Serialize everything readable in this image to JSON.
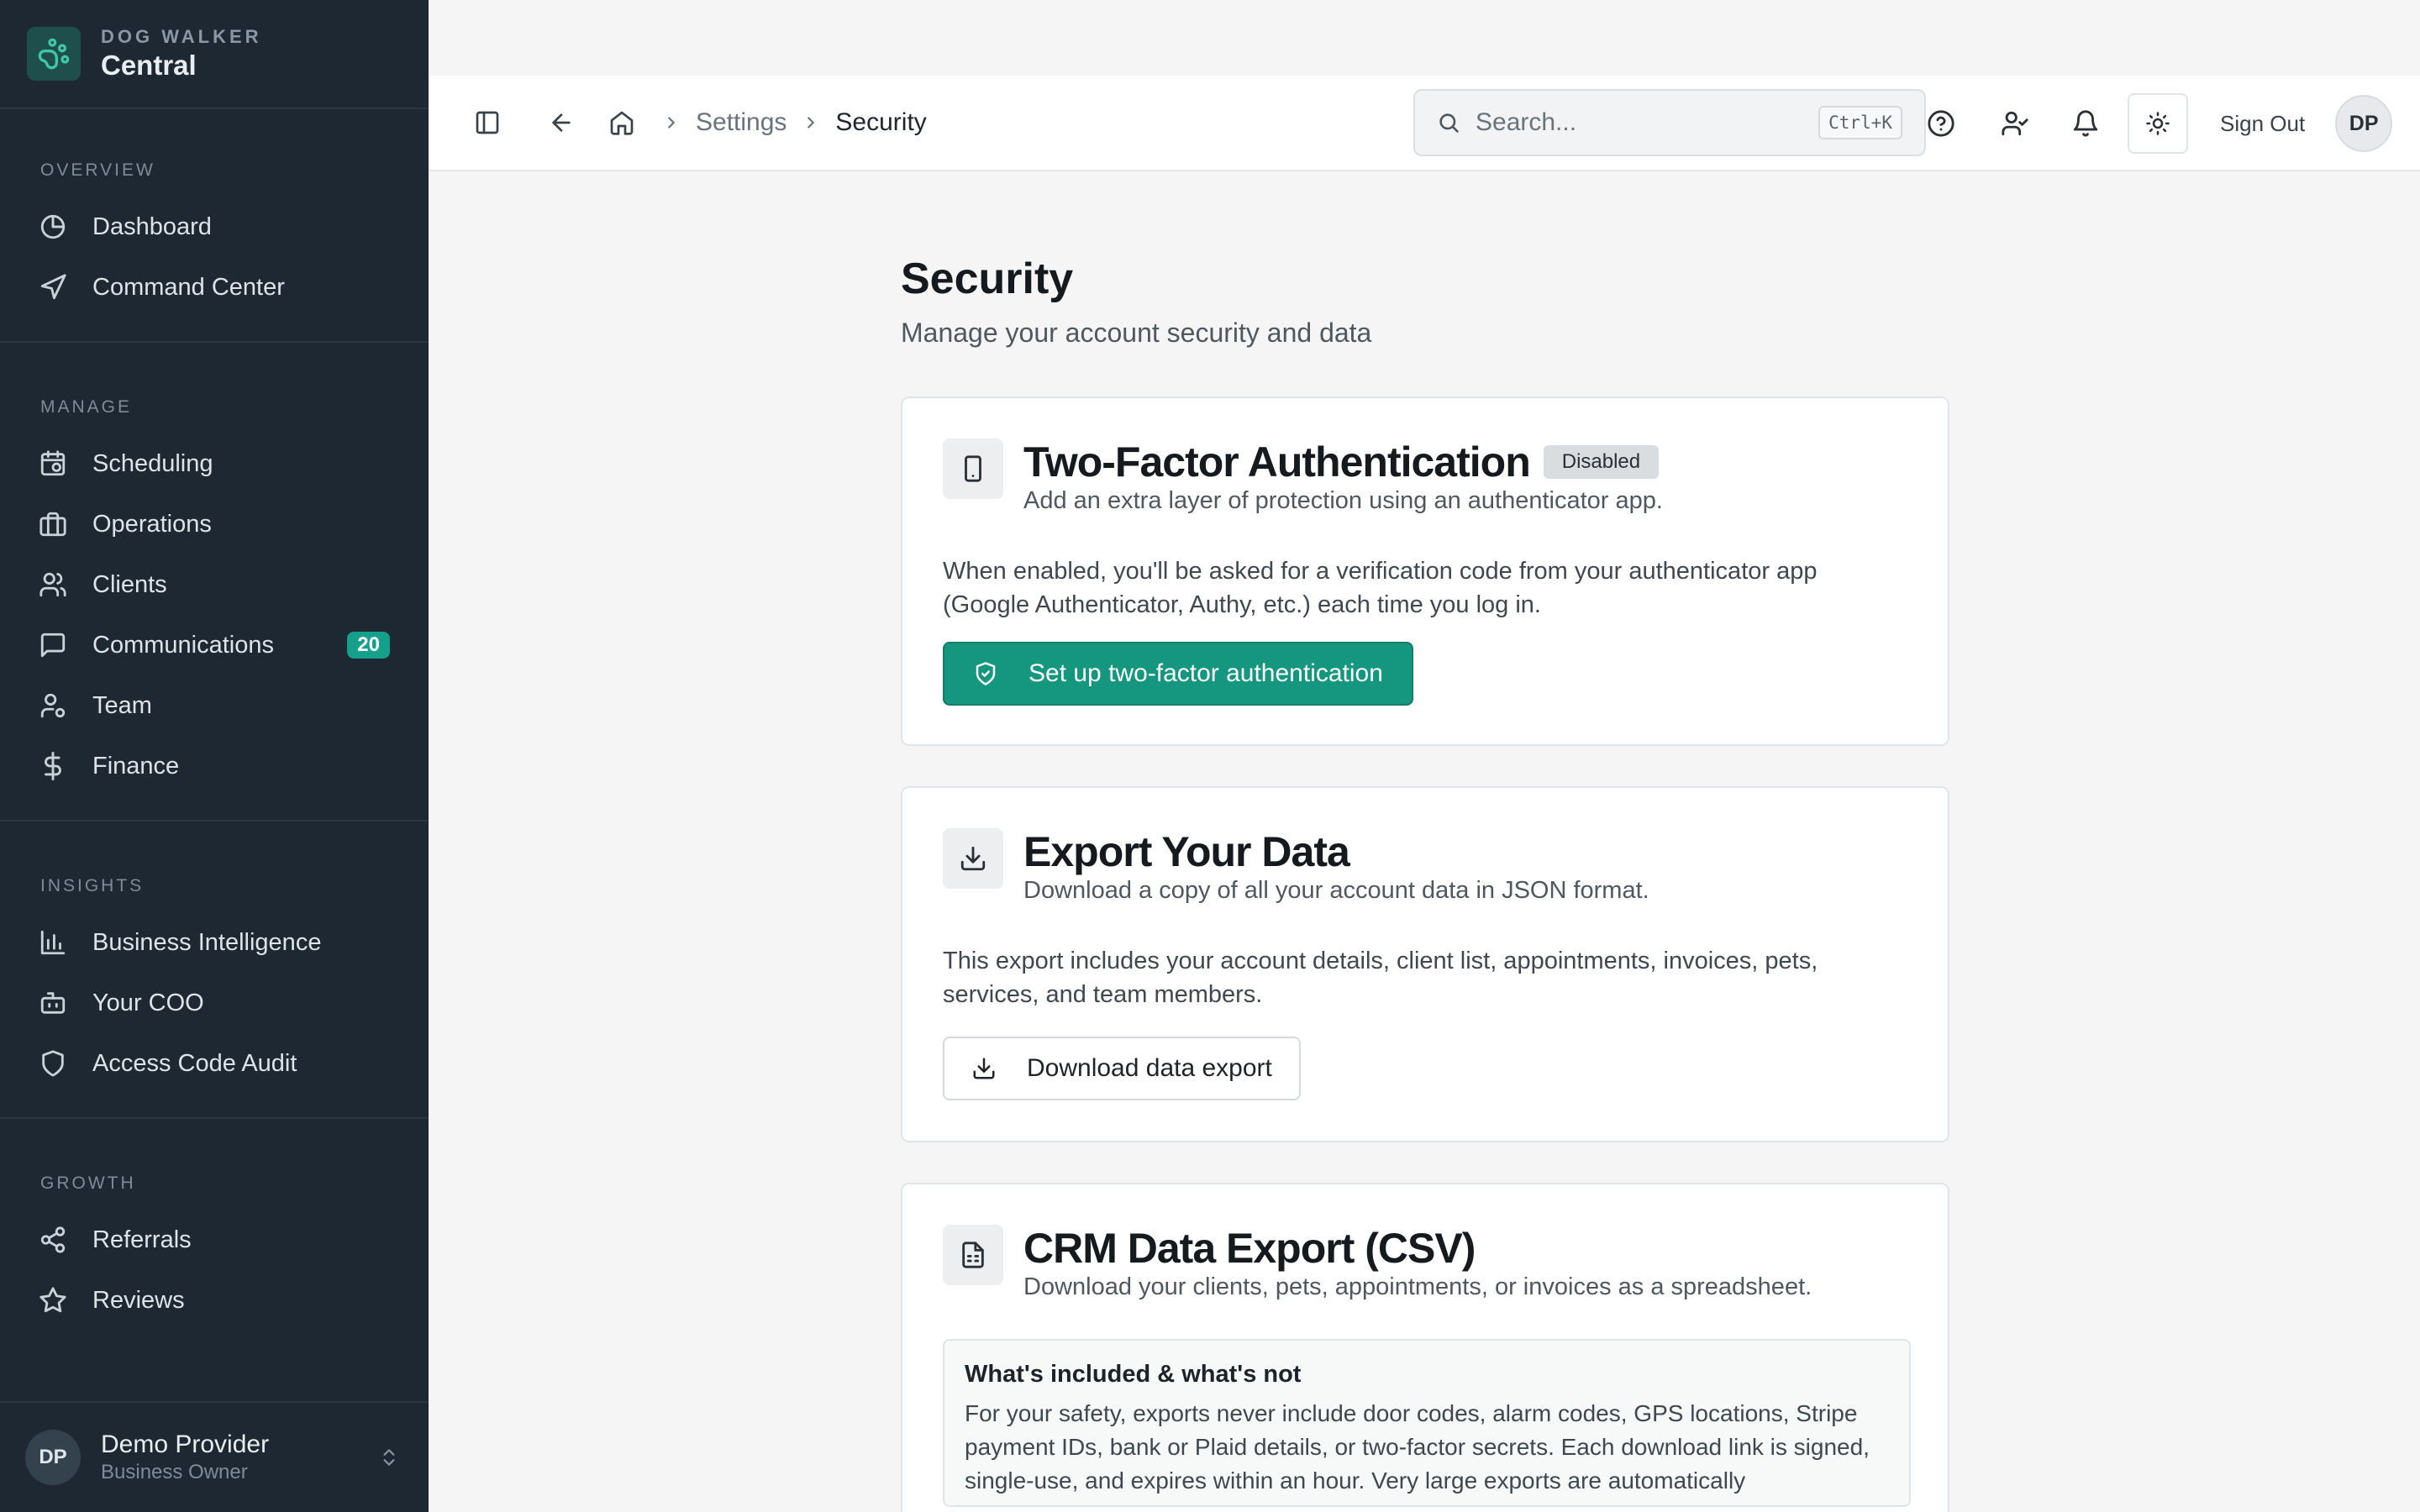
{
  "brand": {
    "subtitle": "DOG WALKER",
    "name": "Central"
  },
  "sidebar": {
    "sections": [
      {
        "title": "OVERVIEW",
        "items": [
          {
            "label": "Dashboard"
          },
          {
            "label": "Command Center"
          }
        ]
      },
      {
        "title": "MANAGE",
        "items": [
          {
            "label": "Scheduling"
          },
          {
            "label": "Operations"
          },
          {
            "label": "Clients"
          },
          {
            "label": "Communications",
            "badge": "20"
          },
          {
            "label": "Team"
          },
          {
            "label": "Finance"
          }
        ]
      },
      {
        "title": "INSIGHTS",
        "items": [
          {
            "label": "Business Intelligence"
          },
          {
            "label": "Your COO"
          },
          {
            "label": "Access Code Audit"
          }
        ]
      },
      {
        "title": "GROWTH",
        "items": [
          {
            "label": "Referrals"
          },
          {
            "label": "Reviews"
          }
        ]
      }
    ],
    "user": {
      "initials": "DP",
      "name": "Demo Provider",
      "role": "Business Owner"
    }
  },
  "topbar": {
    "breadcrumb": {
      "settings": "Settings",
      "current": "Security"
    },
    "search": {
      "placeholder": "Search...",
      "shortcut": "Ctrl+K"
    },
    "sign_out": "Sign Out",
    "avatar_initials": "DP"
  },
  "page": {
    "title": "Security",
    "subtitle": "Manage your account security and data"
  },
  "two_factor": {
    "title": "Two-Factor Authentication",
    "status": "Disabled",
    "description": "Add an extra layer of protection using an authenticator app.",
    "body": "When enabled, you'll be asked for a verification code from your authenticator app (Google Authenticator, Authy, etc.) each time you log in.",
    "button": "Set up two-factor authentication"
  },
  "export_data": {
    "title": "Export Your Data",
    "description": "Download a copy of all your account data in JSON format.",
    "body": "This export includes your account details, client list, appointments, invoices, pets, services, and team members.",
    "button": "Download data export"
  },
  "crm_export": {
    "title": "CRM Data Export (CSV)",
    "description": "Download your clients, pets, appointments, or invoices as a spreadsheet.",
    "info_title": "What's included & what's not",
    "info_text": "For your safety, exports never include door codes, alarm codes, GPS locations, Stripe payment IDs, bank or Plaid details, or two-factor secrets. Each download link is signed, single-use, and expires within an hour. Very large exports are automatically"
  },
  "colors": {
    "sidebar_bg": "#1d2832",
    "accent": "#14967f",
    "badge": "#14a08a",
    "page_bg": "#f5f5f5"
  }
}
